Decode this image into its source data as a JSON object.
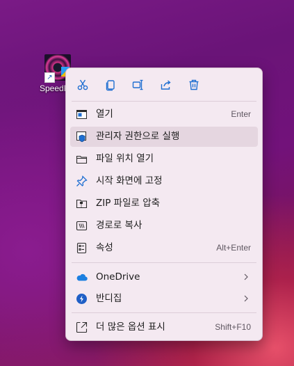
{
  "desktop": {
    "icon_label": "SpeedF"
  },
  "toolbar": {
    "buttons": [
      {
        "name": "cut-icon"
      },
      {
        "name": "copy-icon"
      },
      {
        "name": "rename-icon"
      },
      {
        "name": "share-icon"
      },
      {
        "name": "delete-icon"
      }
    ]
  },
  "menu": {
    "items": [
      {
        "label": "열기",
        "shortcut": "Enter",
        "icon": "open-window-icon"
      },
      {
        "label": "관리자 권한으로 실행",
        "shortcut": "",
        "icon": "admin-shield-icon"
      },
      {
        "label": "파일 위치 열기",
        "shortcut": "",
        "icon": "folder-icon"
      },
      {
        "label": "시작 화면에 고정",
        "shortcut": "",
        "icon": "pin-icon"
      },
      {
        "label": "ZIP 파일로 압축",
        "shortcut": "",
        "icon": "zip-icon"
      },
      {
        "label": "경로로 복사",
        "shortcut": "",
        "icon": "copy-path-icon"
      },
      {
        "label": "속성",
        "shortcut": "Alt+Enter",
        "icon": "properties-icon"
      }
    ],
    "apps": [
      {
        "label": "OneDrive",
        "icon": "onedrive-icon"
      },
      {
        "label": "반디집",
        "icon": "bandizip-icon"
      }
    ],
    "more": {
      "label": "더 많은 옵션 표시",
      "shortcut": "Shift+F10",
      "icon": "more-options-icon"
    }
  },
  "colors": {
    "accent_blue": "#1f6fd1",
    "menu_bg": "#f4e9f1",
    "text": "#1c1c1c"
  }
}
